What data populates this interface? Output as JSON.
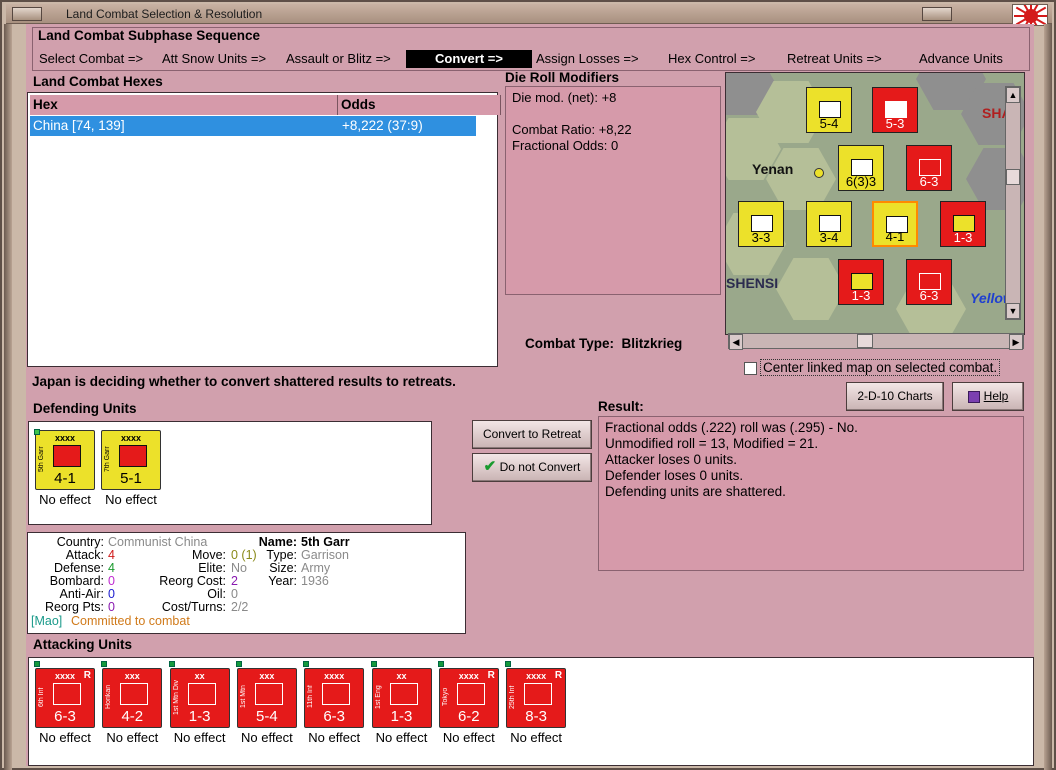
{
  "window": {
    "title": "Land Combat Selection & Resolution"
  },
  "phase": {
    "title": "Land Combat Subphase Sequence",
    "items": [
      "Select Combat =>",
      "Att Snow Units =>",
      "Assault or Blitz =>",
      "Convert =>",
      "Assign Losses =>",
      "Hex Control =>",
      "Retreat Units =>",
      "Advance Units"
    ],
    "current": "Convert =>"
  },
  "hexes": {
    "title": "Land Combat Hexes",
    "columns": [
      "Hex",
      "Odds"
    ],
    "rows": [
      {
        "hex": "China [74, 139]",
        "odds": "+8,222 (37:9)"
      }
    ]
  },
  "modifiers": {
    "title": "Die Roll Modifiers",
    "net": "Die mod. (net): +8",
    "ratio": "Combat Ratio: +8,22",
    "frac": "Fractional Odds: 0"
  },
  "combat_type": {
    "label": "Combat Type:",
    "value": "Blitzkrieg"
  },
  "map": {
    "labels": [
      "Yenan",
      "SHENSI",
      "Yellow",
      "SHA"
    ],
    "center_linked": "Center linked map on selected combat."
  },
  "buttons": {
    "charts": "2-D-10 Charts",
    "help": "Help",
    "convert": "Convert to Retreat",
    "not_convert": "Do not Convert"
  },
  "message": "Japan is deciding whether to convert shattered results to retreats.",
  "defending": {
    "title": "Defending Units",
    "units": [
      {
        "name": "5th Garr",
        "size": "xxxx",
        "strength": "4-1",
        "effect": "No effect"
      },
      {
        "name": "7th Garr",
        "size": "xxxx",
        "strength": "5-1",
        "effect": "No effect"
      }
    ]
  },
  "result": {
    "title": "Result:",
    "lines": [
      "Fractional odds (.222) roll was (.295)  - No.",
      "Unmodified roll = 13, Modified = 21.",
      "Attacker loses 0 units.",
      "Defender loses 0 units.",
      "Defending units are shattered."
    ]
  },
  "info": {
    "country_label": "Country:",
    "country": "Communist China",
    "attack_label": "Attack:",
    "attack": "4",
    "defense_label": "Defense:",
    "defense": "4",
    "bombard_label": "Bombard:",
    "bombard": "0",
    "antiair_label": "Anti-Air:",
    "antiair": "0",
    "reorg_label": "Reorg Pts:",
    "reorg": "0",
    "move_label": "Move:",
    "move": "0 (1)",
    "elite_label": "Elite:",
    "elite": "No",
    "reorgcost_label": "Reorg Cost:",
    "reorgcost": "2",
    "oil_label": "Oil:",
    "oil": "0",
    "costturns_label": "Cost/Turns:",
    "costturns": "2/2",
    "name_label": "Name:",
    "name": "5th Garr",
    "type_label": "Type:",
    "type": "Garrison",
    "size_label": "Size:",
    "size": "Army",
    "year_label": "Year:",
    "year": "1936",
    "leader": "[Mao]",
    "status": "Committed to combat"
  },
  "attacking": {
    "title": "Attacking Units",
    "units": [
      {
        "name": "6th Inf",
        "size": "xxxx",
        "strength": "6-3",
        "effect": "No effect",
        "reserve": "R"
      },
      {
        "name": "Horikan",
        "size": "xxx",
        "strength": "4-2",
        "effect": "No effect",
        "reserve": ""
      },
      {
        "name": "1st Mtn Div",
        "size": "xx",
        "strength": "1-3",
        "effect": "No effect",
        "reserve": ""
      },
      {
        "name": "1st Mtn",
        "size": "xxx",
        "strength": "5-4",
        "effect": "No effect",
        "reserve": ""
      },
      {
        "name": "11th Inf",
        "size": "xxxx",
        "strength": "6-3",
        "effect": "No effect",
        "reserve": ""
      },
      {
        "name": "1st Eng",
        "size": "xx",
        "strength": "1-3",
        "effect": "No effect",
        "reserve": ""
      },
      {
        "name": "Tokyo",
        "size": "xxxx",
        "strength": "6-2",
        "effect": "No effect",
        "reserve": "R"
      },
      {
        "name": "25th Inf",
        "size": "xxxx",
        "strength": "8-3",
        "effect": "No effect",
        "reserve": "R"
      }
    ]
  },
  "colors": {
    "panel": "#d69aaa",
    "selection": "#2f90e0",
    "japan_red": "#e51a1a",
    "china_yellow": "#ece12a"
  }
}
